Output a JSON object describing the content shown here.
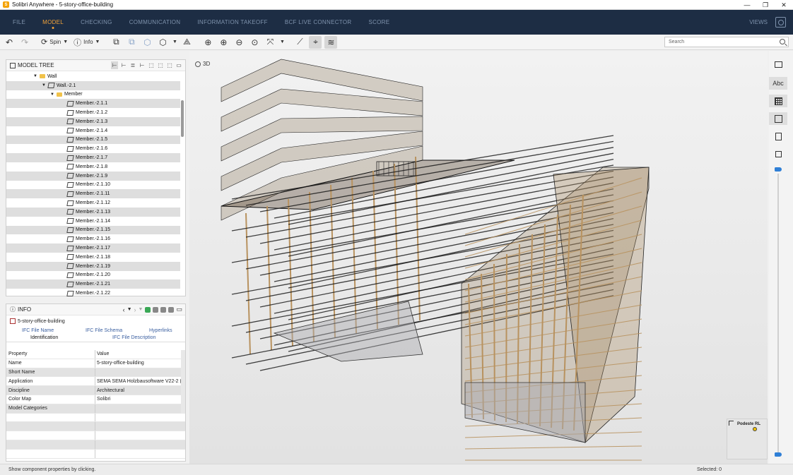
{
  "window": {
    "title": "Solibri Anywhere - 5-story-office-building"
  },
  "menu": {
    "items": [
      "FILE",
      "MODEL",
      "CHECKING",
      "COMMUNICATION",
      "INFORMATION TAKEOFF",
      "BCF LIVE CONNECTOR",
      "SCORE"
    ],
    "active": "MODEL",
    "views_label": "VIEWS"
  },
  "toolbar": {
    "spin_label": "Spin",
    "info_label": "Info",
    "search_placeholder": "Search"
  },
  "model_tree": {
    "title": "MODEL TREE",
    "rows": [
      {
        "label": "Wall",
        "indent": 3,
        "type": "folder",
        "expanded": true
      },
      {
        "label": "Wall.-2.1",
        "indent": 4,
        "type": "part",
        "expanded": true
      },
      {
        "label": "Member",
        "indent": 5,
        "type": "folder",
        "expanded": true
      },
      {
        "label": "Member.-2.1.1",
        "indent": 7,
        "type": "part"
      },
      {
        "label": "Member.-2.1.2",
        "indent": 7,
        "type": "part"
      },
      {
        "label": "Member.-2.1.3",
        "indent": 7,
        "type": "part"
      },
      {
        "label": "Member.-2.1.4",
        "indent": 7,
        "type": "part"
      },
      {
        "label": "Member.-2.1.5",
        "indent": 7,
        "type": "part"
      },
      {
        "label": "Member.-2.1.6",
        "indent": 7,
        "type": "part"
      },
      {
        "label": "Member.-2.1.7",
        "indent": 7,
        "type": "part"
      },
      {
        "label": "Member.-2.1.8",
        "indent": 7,
        "type": "part"
      },
      {
        "label": "Member.-2.1.9",
        "indent": 7,
        "type": "part"
      },
      {
        "label": "Member.-2.1.10",
        "indent": 7,
        "type": "part"
      },
      {
        "label": "Member.-2.1.11",
        "indent": 7,
        "type": "part"
      },
      {
        "label": "Member.-2.1.12",
        "indent": 7,
        "type": "part"
      },
      {
        "label": "Member.-2.1.13",
        "indent": 7,
        "type": "part"
      },
      {
        "label": "Member.-2.1.14",
        "indent": 7,
        "type": "part"
      },
      {
        "label": "Member.-2.1.15",
        "indent": 7,
        "type": "part"
      },
      {
        "label": "Member.-2.1.16",
        "indent": 7,
        "type": "part"
      },
      {
        "label": "Member.-2.1.17",
        "indent": 7,
        "type": "part"
      },
      {
        "label": "Member.-2.1.18",
        "indent": 7,
        "type": "part"
      },
      {
        "label": "Member.-2.1.19",
        "indent": 7,
        "type": "part"
      },
      {
        "label": "Member.-2.1.20",
        "indent": 7,
        "type": "part"
      },
      {
        "label": "Member.-2.1.21",
        "indent": 7,
        "type": "part"
      },
      {
        "label": "Member.-2.1.22",
        "indent": 7,
        "type": "part"
      }
    ]
  },
  "info": {
    "title": "INFO",
    "object_name": "5-story-office-building",
    "tabs_row1": [
      "IFC File Name",
      "IFC File Schema",
      "Hyperlinks"
    ],
    "tabs_row2": [
      "Identification",
      "IFC File Description"
    ],
    "active_tab": "Identification",
    "columns": {
      "property": "Property",
      "value": "Value"
    },
    "rows": [
      {
        "property": "Name",
        "value": "5-story-office-building"
      },
      {
        "property": "Short Name",
        "value": ""
      },
      {
        "property": "Application",
        "value": "SEMA SEMA Holzbausoftware V22-2 (..."
      },
      {
        "property": "Discipline",
        "value": "Architectural"
      },
      {
        "property": "Color Map",
        "value": "Solibri"
      },
      {
        "property": "Model Categories",
        "value": ""
      },
      {
        "property": "",
        "value": ""
      },
      {
        "property": "",
        "value": ""
      },
      {
        "property": "",
        "value": ""
      },
      {
        "property": "",
        "value": ""
      },
      {
        "property": "",
        "value": ""
      }
    ]
  },
  "viewport": {
    "label": "3D"
  },
  "right_bar": {
    "text_tool": "Abc"
  },
  "minimap": {
    "label": "Podeste RL"
  },
  "status": {
    "hint": "Show component properties by clicking.",
    "selected": "Selected: 0"
  },
  "colors": {
    "menubar_bg": "#1d2d44",
    "menu_active": "#f2a33a",
    "menu_inactive": "#7f93ad",
    "slider_accent": "#2f7fd6",
    "wood": "#b8925f"
  }
}
